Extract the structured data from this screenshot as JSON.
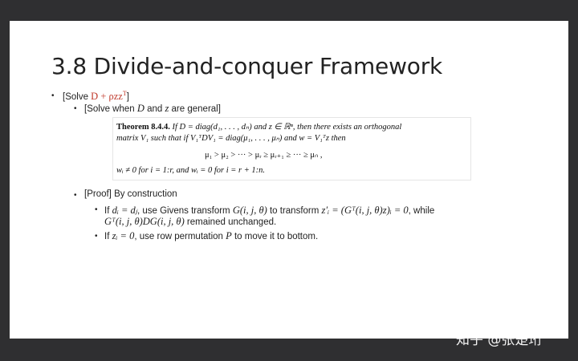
{
  "slide": {
    "title": "3.8 Divide-and-conquer Framework",
    "bullet1": {
      "prefix": "[Solve ",
      "math": "D + ρzz",
      "sup": "T",
      "suffix": "]"
    },
    "bullet1_1": {
      "prefix": "[Solve when ",
      "D": "D",
      "middle": " and ",
      "z": "z",
      "suffix": " are general]"
    },
    "theorem": {
      "label": "Theorem 8.4.4.",
      "line1": " If D = diag(d₁, . . . , dₙ) and z ∈ ℝⁿ, then there exists an orthogonal",
      "line2": "matrix V₁ such that if V₁ᵀDV₁ = diag(μ₁, . . . , μₙ) and w = V₁ᵀz then",
      "line3": "μ₁ > μ₂ > ··· > μᵣ ≥ μᵣ₊₁ ≥ ··· ≥ μₙ ,",
      "line4": "wᵢ ≠ 0 for i = 1:r,  and wᵢ = 0 for i = r + 1:n."
    },
    "bullet2": "[Proof] By construction",
    "sub1_line1": {
      "a": "If ",
      "m1": "dᵢ = dⱼ",
      "b": ", use Givens transform ",
      "m2": "G(i, j, θ)",
      "c": " to transform ",
      "m3": "z′ᵢ = (Gᵀ(i, j, θ)z)ᵢ = 0",
      "d": ", while"
    },
    "sub1_line2": {
      "m1": "Gᵀ(i, j, θ)DG(i, j, θ)",
      "a": " remained unchanged."
    },
    "sub2": {
      "a": "If ",
      "m1": "zᵢ = 0",
      "b": ", use row permutation ",
      "m2": "P",
      "c": " to move it to bottom."
    }
  },
  "watermark": "知乎 @张楚珩"
}
